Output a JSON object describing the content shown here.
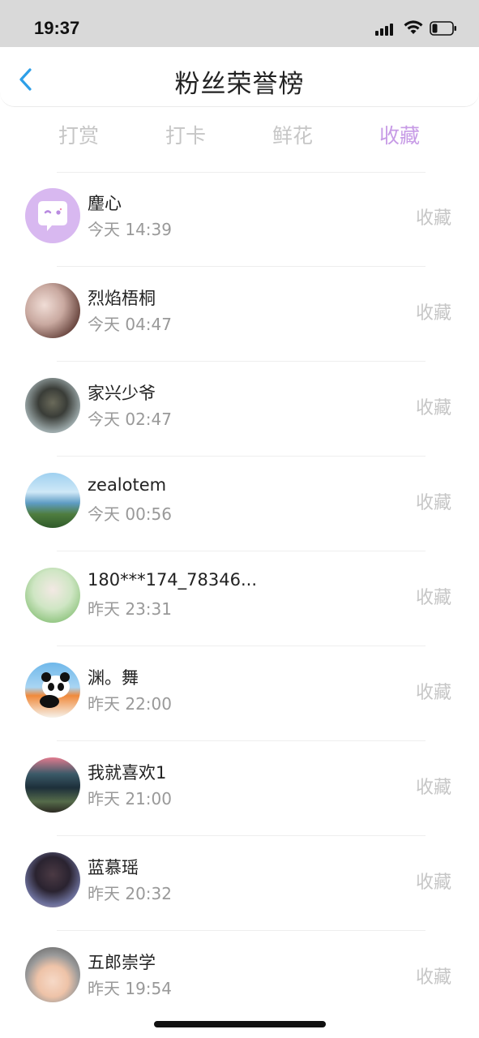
{
  "status_bar": {
    "time": "19:37"
  },
  "header": {
    "title": "粉丝荣誉榜"
  },
  "tabs": [
    {
      "label": "打赏",
      "active": false
    },
    {
      "label": "打卡",
      "active": false
    },
    {
      "label": "鲜花",
      "active": false
    },
    {
      "label": "收藏",
      "active": true
    }
  ],
  "colors": {
    "accent": "#c79be6",
    "muted": "#c6c6c6",
    "back_arrow": "#2d9fe8"
  },
  "fans": [
    {
      "name": "麈心",
      "time": "今天 14:39",
      "action": "收藏",
      "avatar": "purple-chat-avatar"
    },
    {
      "name": "烈焰梧桐",
      "time": "今天 04:47",
      "action": "收藏",
      "avatar": "photo-avatar"
    },
    {
      "name": "家兴少爷",
      "time": "今天 02:47",
      "action": "收藏",
      "avatar": "photo-avatar"
    },
    {
      "name": "zealotem",
      "time": "今天 00:56",
      "action": "收藏",
      "avatar": "landscape-avatar"
    },
    {
      "name": "180***174_78346...",
      "time": "昨天 23:31",
      "action": "收藏",
      "avatar": "anime-avatar"
    },
    {
      "name": "渊。舞",
      "time": "昨天 22:00",
      "action": "收藏",
      "avatar": "panda-avatar"
    },
    {
      "name": "我就喜欢1",
      "time": "昨天 21:00",
      "action": "收藏",
      "avatar": "night-sky-avatar"
    },
    {
      "name": "蓝慕瑶",
      "time": "昨天 20:32",
      "action": "收藏",
      "avatar": "photo-avatar"
    },
    {
      "name": "五郎崇学",
      "time": "昨天 19:54",
      "action": "收藏",
      "avatar": "baby-avatar"
    }
  ]
}
